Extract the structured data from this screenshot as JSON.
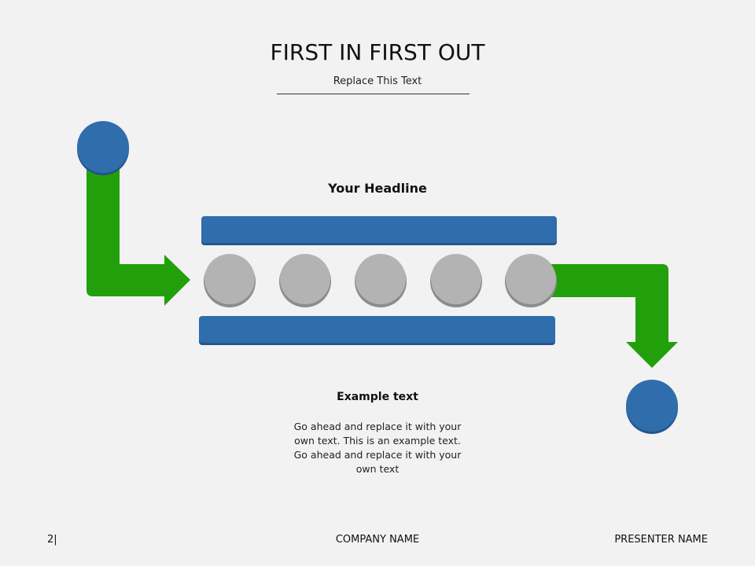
{
  "slide": {
    "title": "FIRST IN FIRST OUT",
    "subtitle": "Replace This Text",
    "headline": "Your Headline",
    "example_title": "Example text",
    "example_body": "Go ahead and replace it with your own text. This is an example text. Go ahead and replace it with your own text"
  },
  "footer": {
    "page": "2|",
    "company": "COMPANY NAME",
    "presenter": "PRESENTER NAME"
  },
  "colors": {
    "blue": "#2f6dad",
    "blue_dark": "#24558a",
    "green": "#22a00c",
    "gray": "#b3b3b3",
    "gray_dark": "#8c8c8c",
    "background": "#f2f2f2"
  }
}
